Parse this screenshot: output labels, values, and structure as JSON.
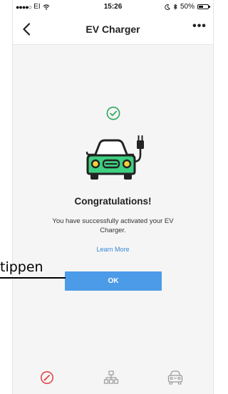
{
  "status_bar": {
    "carrier": "EI",
    "time": "15:26",
    "battery": "50%"
  },
  "nav": {
    "title": "EV Charger",
    "more_label": "•••"
  },
  "success": {
    "headline": "Congratulations!",
    "description": "You have successfully activated your EV Charger.",
    "learn_more": "Learn More",
    "ok_label": "OK"
  },
  "annotation": {
    "label": "tippen"
  },
  "colors": {
    "accent_green": "#2aa85b",
    "car_green": "#3ecf82",
    "button_blue": "#4c9be8",
    "link_blue": "#3a86d6",
    "tab_active_red": "#e2474b"
  },
  "icons": {
    "success": "check-circle-icon",
    "car": "ev-car-icon",
    "tabs": [
      "dashboard-gauge-icon",
      "network-icon",
      "vehicle-icon"
    ]
  }
}
